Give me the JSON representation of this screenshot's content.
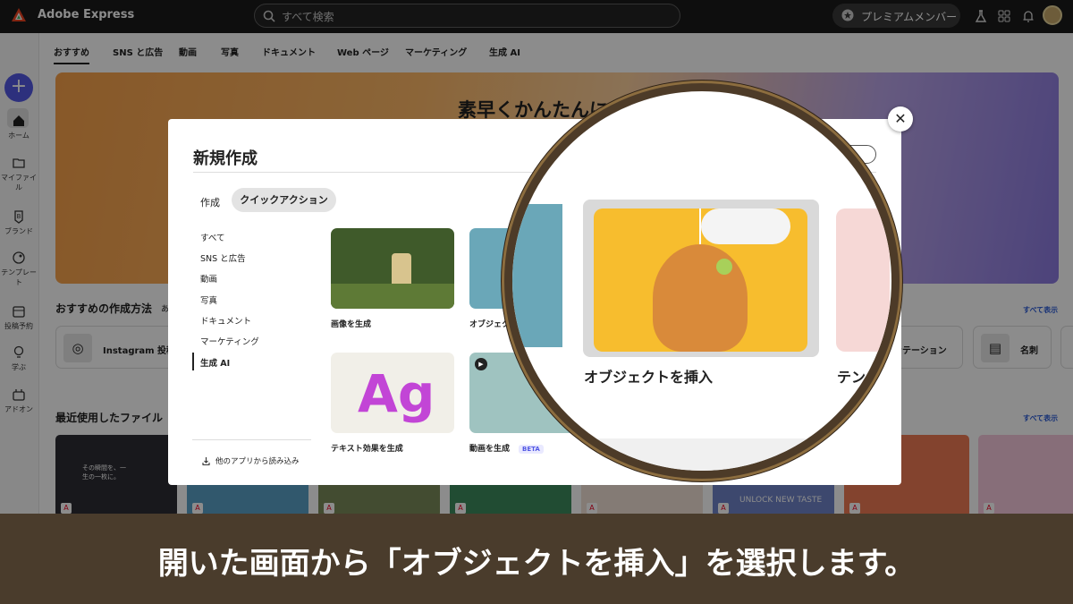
{
  "topbar": {
    "brand": "Adobe Express",
    "search_placeholder": "すべて検索",
    "premium_label": "プレミアムメンバー",
    "icons": [
      "labs-icon",
      "apps-grid-icon",
      "bell-icon",
      "avatar"
    ]
  },
  "sidebar": {
    "items": [
      {
        "label": "ホーム",
        "icon": "home-icon"
      },
      {
        "label": "マイファイル",
        "icon": "folder-icon"
      },
      {
        "label": "ブランド",
        "icon": "brand-icon"
      },
      {
        "label": "テンプレート",
        "icon": "template-icon"
      },
      {
        "label": "投稿予約",
        "icon": "calendar-icon"
      },
      {
        "label": "学ぶ",
        "icon": "bulb-icon"
      },
      {
        "label": "アドオン",
        "icon": "addon-icon"
      }
    ]
  },
  "nav_tabs": [
    "おすすめ",
    "SNS と広告",
    "動画",
    "写真",
    "ドキュメント",
    "Web ページ",
    "マーケティング",
    "生成 AI"
  ],
  "hero": {
    "title": "素早くかんたんに"
  },
  "recommend": {
    "title": "おすすめの作成方法",
    "title_suffix": "あ",
    "see_all": "すべて表示",
    "cards": [
      {
        "label": "Instagram 投稿",
        "icon": "instagram-icon"
      },
      {
        "label": "ンテーション",
        "icon": "presentation-icon"
      },
      {
        "label": "名刺",
        "icon": "business-card-icon"
      }
    ]
  },
  "recent": {
    "title": "最近使用したファイル",
    "see_all": "すべて表示",
    "thumb_texts": [
      "その瞬間を、一生の一枚に。",
      "UNLOCK NEW TASTE"
    ]
  },
  "modal": {
    "title": "新規作成",
    "tabs": [
      "作成",
      "クイックアクション"
    ],
    "selected_tab": "クイックアクション",
    "categories": [
      "すべて",
      "SNS と広告",
      "動画",
      "写真",
      "ドキュメント",
      "マーケティング",
      "生成 AI"
    ],
    "selected_category": "生成 AI",
    "import_label": "他のアプリから読み込み",
    "tiles": [
      {
        "label": "画像を生成"
      },
      {
        "label": "オブジェク"
      },
      {
        "label": "テキスト効果を生成"
      },
      {
        "label": "動画を生成",
        "badge": "BETA"
      }
    ],
    "tile_glyph": "Ag"
  },
  "magnifier": {
    "label": "オブジェクトを挿入",
    "label_next": "テン"
  },
  "caption": {
    "text": "開いた画面から「オブジェクトを挿入」を選択します。"
  },
  "colors": {
    "accent": "#5258e4",
    "caption_bg": "#4a3c2c",
    "ring": "#4d3b28"
  }
}
